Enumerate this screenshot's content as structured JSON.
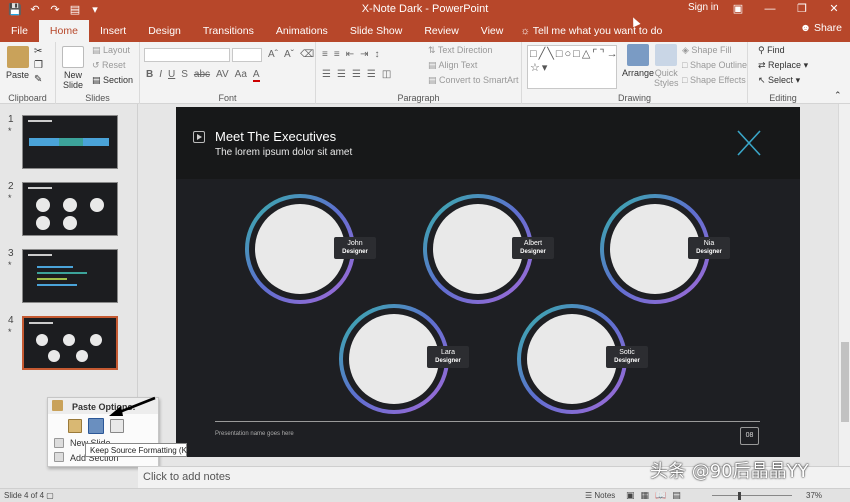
{
  "app": {
    "title": "X-Note Dark  -  PowerPoint",
    "signin": "Sign in",
    "share": "Share",
    "window_controls": [
      "ribbon-display",
      "minimize",
      "restore",
      "close"
    ]
  },
  "tabs": [
    "File",
    "Home",
    "Insert",
    "Design",
    "Transitions",
    "Animations",
    "Slide Show",
    "Review",
    "View"
  ],
  "active_tab": "Home",
  "tell_me": "Tell me what you want to do",
  "ribbon": {
    "clipboard": {
      "label": "Clipboard",
      "paste": "Paste"
    },
    "slides": {
      "label": "Slides",
      "new_slide": "New",
      "new_slide_2": "Slide",
      "layout": "Layout",
      "reset": "Reset",
      "section": "Section"
    },
    "font": {
      "label": "Font",
      "buttons": [
        "B",
        "I",
        "U",
        "S",
        "abc",
        "AV",
        "Aa",
        "A"
      ]
    },
    "paragraph": {
      "label": "Paragraph",
      "text_direction": "Text Direction",
      "align_text": "Align Text",
      "convert": "Convert to SmartArt"
    },
    "drawing": {
      "label": "Drawing",
      "arrange": "Arrange",
      "quick_styles": "Quick",
      "quick_styles_2": "Styles",
      "shape_fill": "Shape Fill",
      "shape_outline": "Shape Outline",
      "shape_effects": "Shape Effects"
    },
    "editing": {
      "label": "Editing",
      "find": "Find",
      "replace": "Replace",
      "select": "Select"
    }
  },
  "thumbnails": [
    {
      "num": "1",
      "star": "*"
    },
    {
      "num": "2",
      "star": "*"
    },
    {
      "num": "3",
      "star": "*"
    },
    {
      "num": "4",
      "star": "*"
    }
  ],
  "slide": {
    "title": "Meet The Executives",
    "subtitle": "The lorem ipsum dolor sit amet",
    "people": [
      {
        "name": "John",
        "role": "Designer"
      },
      {
        "name": "Albert",
        "role": "Designer"
      },
      {
        "name": "Nia",
        "role": "Designer"
      },
      {
        "name": "Lara",
        "role": "Designer"
      },
      {
        "name": "Sotic",
        "role": "Designer"
      }
    ],
    "footer": "Presentation name goes here",
    "page": "08"
  },
  "context_menu": {
    "header": "Paste Options:",
    "items": [
      "New Slide",
      "Add Section"
    ]
  },
  "tooltip": "Keep Source Formatting (K)",
  "notes": "Click to add notes",
  "status": {
    "slide_info": "Slide 4 of 4",
    "notes": "Notes",
    "zoom": "37%"
  },
  "watermark": "头条 @90后晶晶YY",
  "colors": {
    "accent": "#b7472a",
    "slide_bg": "#1e1f23",
    "ring_start": "#36b3a8",
    "ring_end": "#a66ad8"
  }
}
